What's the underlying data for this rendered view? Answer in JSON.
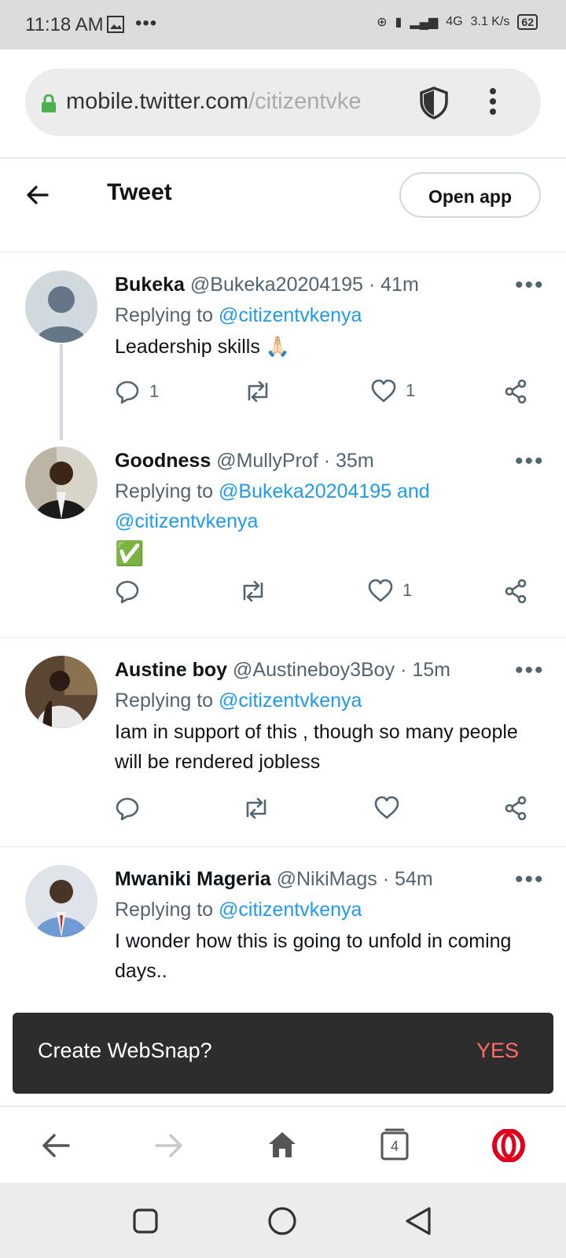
{
  "status_bar": {
    "time": "11:18 AM",
    "network": "4G",
    "speed": "3.1 K/s",
    "battery": "62"
  },
  "browser": {
    "url_host": "mobile.twitter.com",
    "url_path": "/citizentvke"
  },
  "header": {
    "title": "Tweet",
    "open_app_label": "Open app"
  },
  "tweets": [
    {
      "name": "Bukeka",
      "handle": "@Bukeka20204195",
      "time": "· 41m",
      "replying_prefix": "Replying to ",
      "replying_to": "@citizentvkenya",
      "text": "Leadership skills 🙏🏻",
      "reply_count": "1",
      "retweet_count": "",
      "like_count": "1"
    },
    {
      "name": "Goodness",
      "handle": "@MullyProf",
      "time": "· 35m",
      "replying_prefix": "Replying to ",
      "replying_to": "@Bukeka20204195 and @citizentvkenya",
      "text": "✅",
      "reply_count": "",
      "retweet_count": "",
      "like_count": "1"
    },
    {
      "name": "Austine boy",
      "handle": "@Austineboy3Boy",
      "time": "· 15m",
      "replying_prefix": "Replying to ",
      "replying_to": "@citizentvkenya",
      "text": "Iam in support of this , though so many people will be rendered jobless",
      "reply_count": "",
      "retweet_count": "",
      "like_count": ""
    },
    {
      "name": "Mwaniki Mageria",
      "handle": "@NikiMags",
      "time": "· 54m",
      "replying_prefix": "Replying to ",
      "replying_to": "@citizentvkenya",
      "text": "I wonder how this is going to unfold in coming days..",
      "reply_count": "",
      "retweet_count": "",
      "like_count": ""
    }
  ],
  "snackbar": {
    "text": "Create WebSnap?",
    "action": "YES"
  },
  "browser_toolbar": {
    "tab_count": "4"
  },
  "colors": {
    "link": "#1d9bf0",
    "opera_red": "#e0001b",
    "snack_action": "#ff6b6b"
  }
}
